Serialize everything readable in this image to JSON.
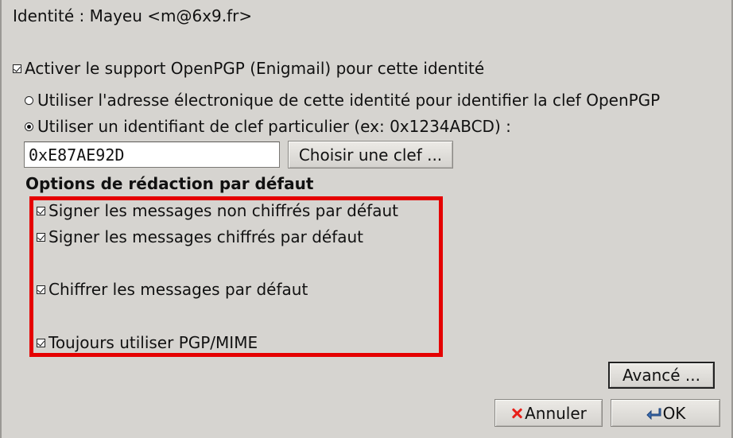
{
  "identity": {
    "label": "Identité : Mayeu <m@6x9.fr>"
  },
  "enable_openpgp": {
    "label": "Activer le support OpenPGP (Enigmail) pour cette identité",
    "checked": true
  },
  "key_selection": {
    "options": [
      {
        "label": "Utiliser l'adresse électronique de cette identité pour identifier la clef OpenPGP",
        "selected": false
      },
      {
        "label": "Utiliser un identifiant de clef particulier (ex: 0x1234ABCD) :",
        "selected": true
      }
    ],
    "key_id_value": "0xE87AE92D",
    "choose_key_label": "Choisir une clef ..."
  },
  "composition": {
    "title": "Options de rédaction par défaut",
    "options": [
      {
        "label": "Signer les messages non chiffrés par défaut",
        "checked": true
      },
      {
        "label": "Signer les messages chiffrés par défaut",
        "checked": true
      },
      {
        "label": "Chiffrer les messages par défaut",
        "checked": true
      },
      {
        "label": "Toujours utiliser PGP/MIME",
        "checked": true
      }
    ]
  },
  "buttons": {
    "advanced": "Avancé ...",
    "cancel": "Annuler",
    "ok": "OK"
  },
  "colors": {
    "background": "#d6d4d0",
    "highlight": "#e50000",
    "cancel_icon": "#e8201a",
    "ok_icon": "#3a6fb5"
  },
  "icons": {
    "cancel": "x-icon",
    "ok": "return-arrow-icon"
  }
}
